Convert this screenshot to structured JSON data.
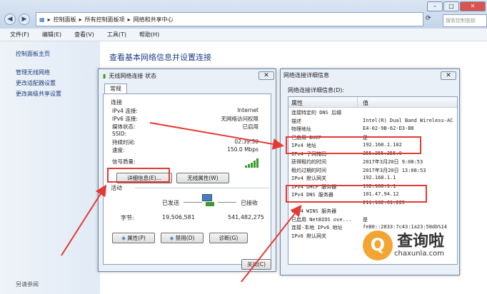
{
  "explorer": {
    "breadcrumb": [
      "控制面板",
      "所有控制面板项",
      "网络和共享中心"
    ],
    "search_placeholder": "搜索控制面板",
    "menu": [
      "文件(F)",
      "编辑(E)",
      "查看(V)",
      "工具(T)",
      "帮助(H)"
    ],
    "sidebar": [
      "控制面板主页",
      "管理无线网络",
      "更改适配器设置",
      "更改高级共享设置"
    ],
    "see_also": "另请参阅",
    "main_title": "查看基本网络信息并设置连接"
  },
  "status_dialog": {
    "title": "无线网络连接 状态",
    "tab": "常规",
    "connection_label": "连接",
    "rows": [
      {
        "k": "IPv4 连接:",
        "v": "Internet"
      },
      {
        "k": "IPv6 连接:",
        "v": "无网络访问权限"
      },
      {
        "k": "媒体状态:",
        "v": "已启用"
      },
      {
        "k": "SSID:",
        "v": ""
      },
      {
        "k": "持续时间:",
        "v": "02:39:30"
      },
      {
        "k": "速度:",
        "v": "150.0 Mbps"
      }
    ],
    "signal_label": "信号质量:",
    "details_button": "详细信息(E)...",
    "wireless_button": "无线属性(W)",
    "activity_label": "活动",
    "sent_label": "已发送",
    "received_label": "已接收",
    "bytes_label": "字节:",
    "bytes_sent": "19,506,581",
    "bytes_received": "541,482,275",
    "properties_button": "属性(P)",
    "disable_button": "禁用(D)",
    "diagnose_button": "诊断(G)",
    "close_button": "关闭(C)"
  },
  "details_dialog": {
    "title": "网络连接详细信息",
    "subtitle": "网络连接详细信息(D):",
    "col_property": "属性",
    "col_value": "值",
    "rows": [
      {
        "p": "连接特定的 DNS 后缀",
        "v": ""
      },
      {
        "p": "描述",
        "v": "Intel(R) Dual Band Wireless-AC"
      },
      {
        "p": "物理地址",
        "v": "E4-02-9B-62-D3-B8"
      },
      {
        "p": "已启用 DHCP",
        "v": "是"
      },
      {
        "p": "IPv4 地址",
        "v": "192.168.1.102"
      },
      {
        "p": "IPv4 子网掩码",
        "v": "255.255.255.0"
      },
      {
        "p": "获得租约的时间",
        "v": "2017年3月20日 9:08:53"
      },
      {
        "p": "租约过期的时间",
        "v": "2017年3月20日 13:08:53"
      },
      {
        "p": "IPv4 默认网关",
        "v": "192.168.1.1"
      },
      {
        "p": "IPv4 DHCP 服务器",
        "v": "192.168.1.1"
      },
      {
        "p": "IPv4 DNS 服务器",
        "v": "101.47.94.12"
      },
      {
        "p": "",
        "v": "211.162.61.225"
      },
      {
        "p": "IPv4 WINS 服务器",
        "v": ""
      },
      {
        "p": "已启用 NetBIOS ove...",
        "v": "是"
      },
      {
        "p": "连接-本地 IPv6 地址",
        "v": "fe80::2833:7c43:1a23:58db%14"
      },
      {
        "p": "IPv6 默认网关",
        "v": ""
      }
    ]
  },
  "watermark": {
    "glyph": "Q",
    "text": "查询啦",
    "url": "chaxunla.com"
  },
  "colors": {
    "annotation_red": "#e53935",
    "accent_blue": "#1e3c8a",
    "watermark_orange": "#f3a533"
  }
}
